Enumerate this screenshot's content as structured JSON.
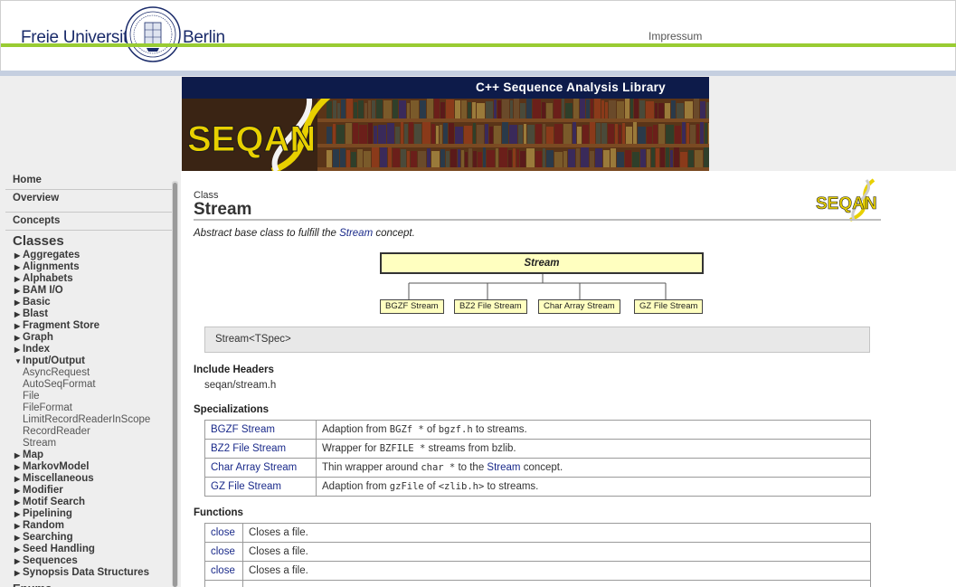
{
  "header": {
    "university_left": "Freie Universität",
    "university_right": "Berlin",
    "impressum": "Impressum",
    "accent_green": "#99cc33",
    "accent_blue": "#c5cfe0"
  },
  "banner": {
    "title": "C++ Sequence Analysis Library",
    "logo_text": "SEQAN"
  },
  "sidebar": {
    "top_items": [
      "Home",
      "Overview",
      "Concepts"
    ],
    "section": "Classes",
    "categories_before": [
      "Aggregates",
      "Alignments",
      "Alphabets",
      "BAM I/O",
      "Basic",
      "Blast",
      "Fragment Store",
      "Graph",
      "Index"
    ],
    "expanded_category": "Input/Output",
    "expanded_items": [
      "AsyncRequest",
      "AutoSeqFormat",
      "File",
      "FileFormat",
      "LimitRecordReaderInScope",
      "RecordReader",
      "Stream"
    ],
    "categories_after": [
      "Map",
      "MarkovModel",
      "Miscellaneous",
      "Modifier",
      "Motif Search",
      "Pipelining",
      "Random",
      "Searching",
      "Seed Handling",
      "Sequences",
      "Synopsis Data Structures"
    ],
    "next_section": "Enums"
  },
  "page": {
    "kind": "Class",
    "title": "Stream",
    "summary_prefix": "Abstract base class to fulfill the ",
    "summary_link": "Stream",
    "summary_suffix": " concept.",
    "diagram": {
      "root": "Stream",
      "children": [
        "BGZF Stream",
        "BZ2 File Stream",
        "Char Array Stream",
        "GZ File Stream"
      ]
    },
    "signature": "Stream<TSpec>",
    "include_headers_title": "Include Headers",
    "include_header": "seqan/stream.h",
    "specializations_title": "Specializations",
    "specializations": [
      {
        "name": "BGZF Stream",
        "d1": "Adaption from ",
        "c1": "BGZf *",
        "d2": " of ",
        "c2": "bgzf.h",
        "d3": " to streams.",
        "link": ""
      },
      {
        "name": "BZ2 File Stream",
        "d1": "Wrapper for ",
        "c1": "BZFILE *",
        "d2": " streams from bzlib.",
        "c2": "",
        "d3": "",
        "link": ""
      },
      {
        "name": "Char Array Stream",
        "d1": "Thin wrapper around ",
        "c1": "char *",
        "d2": " to the ",
        "c2": "",
        "d3": " concept.",
        "link": "Stream"
      },
      {
        "name": "GZ File Stream",
        "d1": "Adaption from ",
        "c1": "gzFile",
        "d2": " of ",
        "c2": "<zlib.h>",
        "d3": " to streams.",
        "link": ""
      }
    ],
    "functions_title": "Functions",
    "functions": [
      {
        "name": "close",
        "desc": "Closes a file."
      },
      {
        "name": "close",
        "desc": "Closes a file."
      },
      {
        "name": "close",
        "desc": "Closes a file."
      },
      {
        "name": "",
        "desc": ""
      }
    ]
  }
}
